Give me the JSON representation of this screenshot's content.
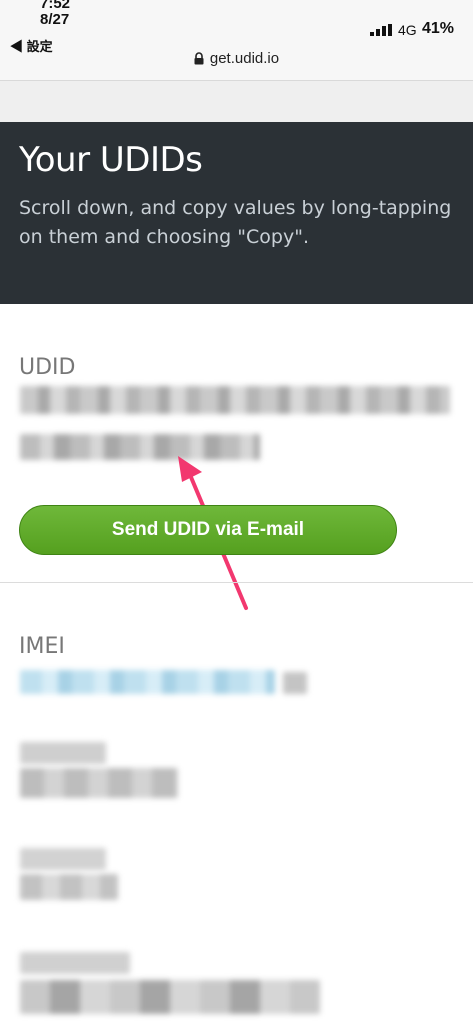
{
  "status": {
    "time_line1": "7:52",
    "time_line2": "8/27",
    "back_label": "◀ 設定",
    "network": "4G",
    "battery": "41%",
    "url": "get.udid.io"
  },
  "header": {
    "title": "Your UDIDs",
    "description": "Scroll down, and copy values by long-tapping on them and choosing \"Copy\"."
  },
  "udid": {
    "label": "UDID",
    "send_button": "Send UDID via E-mail"
  },
  "imei": {
    "label": "IMEI"
  },
  "colors": {
    "header_bg": "#2b3136",
    "button_green": "#5ea828",
    "annotation_arrow": "#f2386f"
  }
}
